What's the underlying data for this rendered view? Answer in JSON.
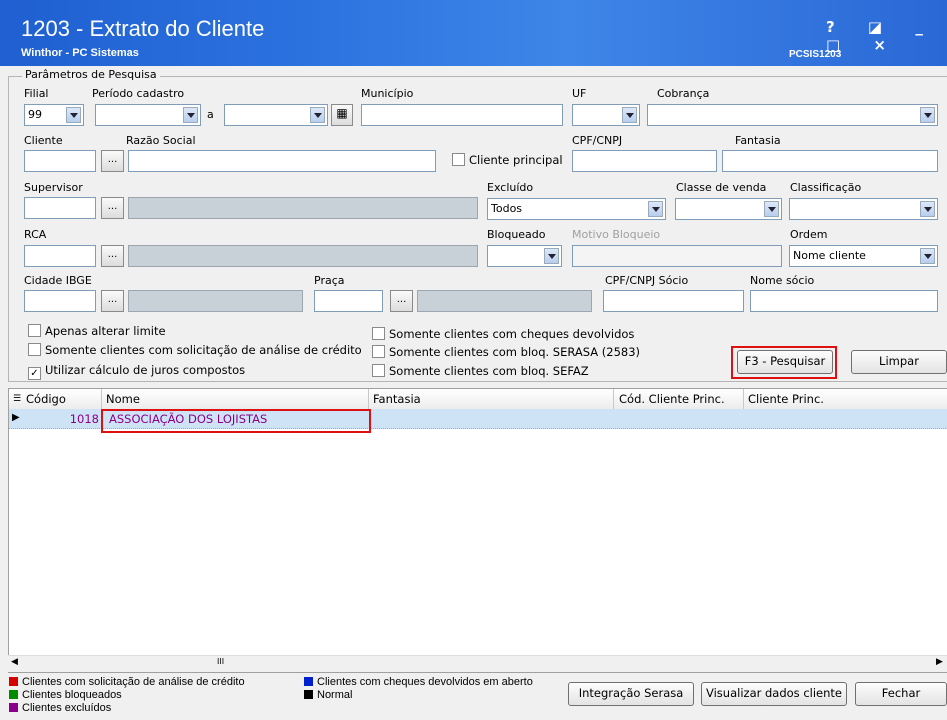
{
  "window": {
    "title": "1203 - Extrato do Cliente",
    "subtitle": "Winthor - PC Sistemas",
    "code": "PCSIS1203",
    "controls": "? ◪ _ □ ×"
  },
  "search": {
    "group_label": "Parâmetros de Pesquisa",
    "filial_label": "Filial",
    "filial_value": "99",
    "periodo_label": "Período cadastro",
    "periodo_sep": "a",
    "municipio_label": "Município",
    "uf_label": "UF",
    "cobranca_label": "Cobrança",
    "cliente_label": "Cliente",
    "razao_label": "Razão Social",
    "cliente_principal_label": "Cliente principal",
    "cpf_label": "CPF/CNPJ",
    "fantasia_label": "Fantasia",
    "supervisor_label": "Supervisor",
    "excluido_label": "Excluído",
    "excluido_value": "Todos",
    "classe_label": "Classe de venda",
    "classificacao_label": "Classificação",
    "rca_label": "RCA",
    "bloqueado_label": "Bloqueado",
    "motivo_label": "Motivo Bloqueio",
    "ordem_label": "Ordem",
    "ordem_value": "Nome cliente",
    "cidade_label": "Cidade IBGE",
    "praca_label": "Praça",
    "cpf_socio_label": "CPF/CNPJ Sócio",
    "nome_socio_label": "Nome sócio",
    "ellipsis": "...",
    "options": [
      {
        "label": "Apenas alterar limite",
        "checked": false
      },
      {
        "label": "Somente clientes com solicitação de análise de crédito",
        "checked": false
      },
      {
        "label": "Utilizar cálculo de juros compostos",
        "checked": true
      },
      {
        "label": "Somente clientes com cheques devolvidos",
        "checked": false
      },
      {
        "label": "Somente clientes com bloq. SERASA (2583)",
        "checked": false
      },
      {
        "label": "Somente clientes com bloq. SEFAZ",
        "checked": false
      }
    ],
    "pesquisar_label": "F3 - Pesquisar",
    "limpar_label": "Limpar"
  },
  "grid": {
    "columns": [
      "Código",
      "Nome",
      "Fantasia",
      "Cód. Cliente Princ.",
      "Cliente Princ."
    ],
    "rows": [
      {
        "codigo": "1018",
        "nome": "ASSOCIAÇÃO DOS LOJISTAS",
        "fantasia": "",
        "cod_princ": "",
        "cliente_princ": ""
      }
    ],
    "scroll_glyph": "III"
  },
  "legend": {
    "items": [
      {
        "label": "Clientes com solicitação de análise de crédito",
        "color": "#d40000"
      },
      {
        "label": "Clientes bloqueados",
        "color": "#008a00"
      },
      {
        "label": "Clientes excluídos",
        "color": "#8a008a"
      },
      {
        "label": "Clientes com cheques devolvidos em aberto",
        "color": "#0020d0"
      },
      {
        "label": "Normal",
        "color": "#000000"
      }
    ]
  },
  "footer": {
    "serasa_label": "Integração Serasa",
    "visualizar_label": "Visualizar dados cliente",
    "fechar_label": "Fechar"
  },
  "colors": {
    "titlebar": "#2d74e0",
    "highlight_box": "#d11111",
    "row_text": "#8a008a",
    "row_background": "#cfe3f6"
  }
}
